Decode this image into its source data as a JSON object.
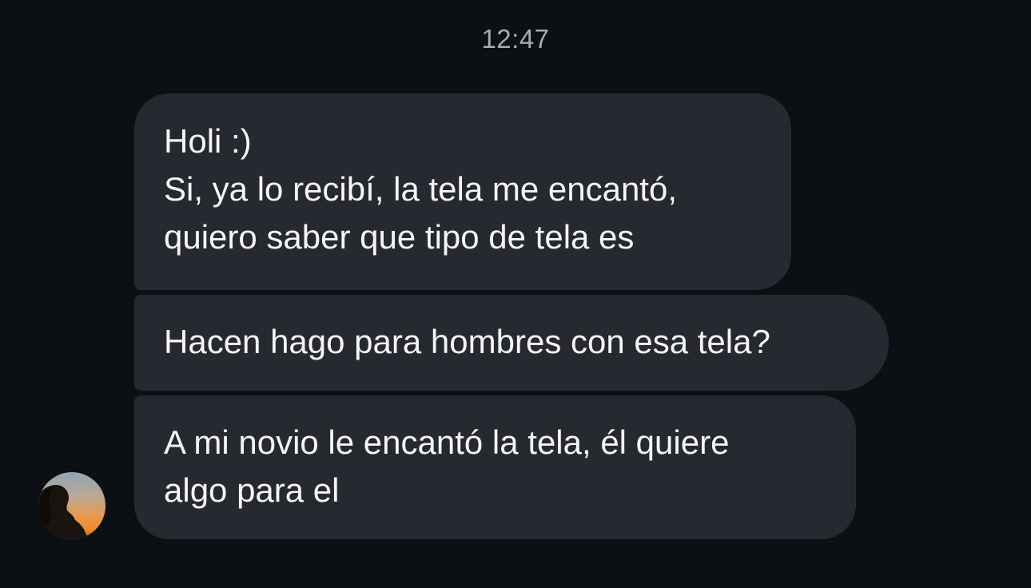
{
  "thread": {
    "timestamp": "12:47",
    "messages": [
      {
        "text": "Holi :)\nSi, ya lo recibí, la tela me encantó,\nquiero saber que tipo de tela es"
      },
      {
        "text": "Hacen hago para hombres con esa tela?"
      },
      {
        "text": "A mi novio le encantó la tela, él quiere\nalgo para el"
      }
    ]
  },
  "colors": {
    "background": "#0c1014",
    "bubble": "#262a30",
    "text": "#f5f5f5",
    "timestamp": "#a8acb2"
  },
  "icons": {
    "avatar": "profile-photo-silhouette-sunset"
  }
}
